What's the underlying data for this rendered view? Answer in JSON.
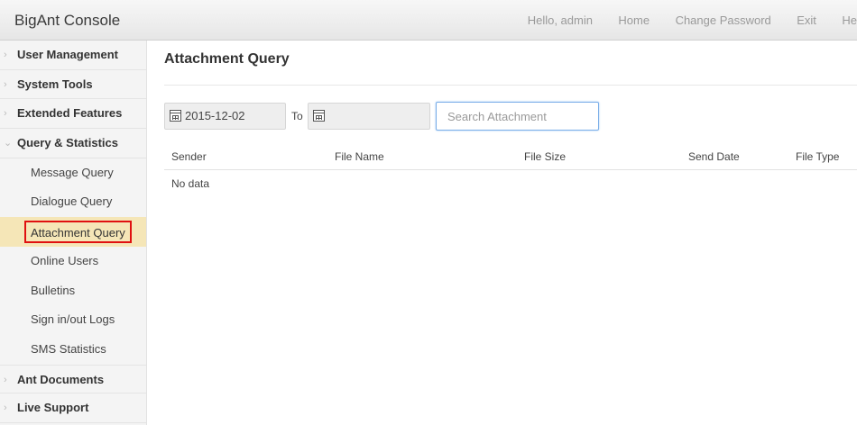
{
  "header": {
    "brand": "BigAnt Console",
    "nav": [
      "Hello, admin",
      "Home",
      "Change Password",
      "Exit",
      "He"
    ]
  },
  "sidebar": {
    "items": [
      {
        "label": "User Management"
      },
      {
        "label": "System Tools"
      },
      {
        "label": "Extended Features"
      },
      {
        "label": "Query & Statistics",
        "expanded": true,
        "children": [
          "Message Query",
          "Dialogue Query",
          "Attachment Query",
          "Online Users",
          "Bulletins",
          "Sign in/out Logs",
          "SMS Statistics"
        ],
        "active_child": "Attachment Query"
      },
      {
        "label": "Ant Documents"
      },
      {
        "label": "Live Support"
      }
    ]
  },
  "main": {
    "title": "Attachment Query",
    "from_date": "2015-12-02",
    "to_label": "To",
    "to_date": "",
    "search_placeholder": "Search Attachment",
    "columns": [
      "Sender",
      "File Name",
      "File Size",
      "Send Date",
      "File Type"
    ],
    "empty_text": "No data"
  },
  "colors": {
    "active_bg": "#f5e6b7",
    "highlight_border": "#e01010",
    "search_focus": "#7aaee8"
  }
}
